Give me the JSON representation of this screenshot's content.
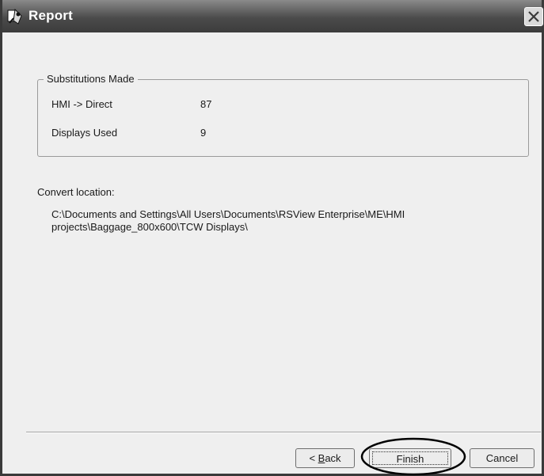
{
  "window": {
    "title": "Report",
    "close_glyph": "✕"
  },
  "substitutions": {
    "legend": "Substitutions Made",
    "rows": [
      {
        "label": "HMI -> Direct",
        "value": "87"
      },
      {
        "label": "Displays Used",
        "value": "9"
      }
    ]
  },
  "convert": {
    "label": "Convert location:",
    "path_line1": "C:\\Documents and Settings\\All Users\\Documents\\RSView Enterprise\\ME\\HMI",
    "path_line2": "projects\\Baggage_800x600\\TCW Displays\\"
  },
  "buttons": {
    "back_prefix": "< ",
    "back_mnemonic": "B",
    "back_rest": "ack",
    "finish": "Finish",
    "cancel": "Cancel"
  },
  "icons": {
    "app": "wizard-app-icon",
    "close": "close-icon"
  },
  "colors": {
    "titlebar": "#4b4b4b",
    "dialog_bg": "#efefef",
    "highlight_ellipse": "#000000"
  }
}
